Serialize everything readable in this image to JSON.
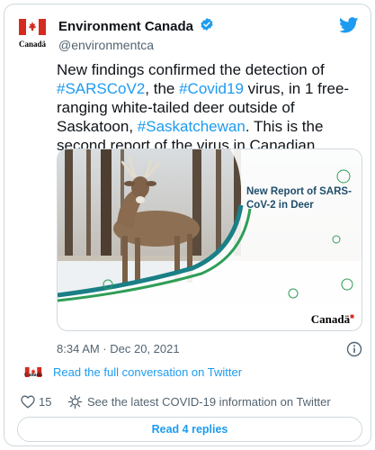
{
  "author": {
    "display_name": "Environment Canada",
    "handle": "@environmentca",
    "avatar_wordmark": "Canadä"
  },
  "tweet": {
    "segments": [
      {
        "text": "New findings confirmed the detection of ",
        "type": "text"
      },
      {
        "text": "#SARSCoV2",
        "type": "hashtag"
      },
      {
        "text": ", the ",
        "type": "text"
      },
      {
        "text": "#Covid19",
        "type": "hashtag"
      },
      {
        "text": " virus, in 1 free-ranging white-tailed deer outside of Saskatoon, ",
        "type": "text"
      },
      {
        "text": "#Saskatchewan",
        "type": "hashtag"
      },
      {
        "text": ". This is the second report of the virus in Canadian wildlife.",
        "type": "text"
      }
    ]
  },
  "media": {
    "overlay_title": "New Report of SARS-CoV-2 in Deer",
    "wordmark": "Canadä"
  },
  "meta": {
    "timestamp": "8:34 AM · Dec 20, 2021"
  },
  "conversation": {
    "link_text": "Read the full conversation on Twitter",
    "flag_wordmark": "Canadä"
  },
  "actions": {
    "like_count": "15",
    "covid_link": "See the latest COVID-19 information on Twitter"
  },
  "replies_button": "Read 4 replies",
  "colors": {
    "accent": "#1d9bf0",
    "canada_red": "#d52b1e",
    "overlay_teal": "#1a7f86",
    "overlay_green": "#2f9e57"
  },
  "icons": {
    "header": "twitter-bird-icon",
    "verified": "verified-badge-icon",
    "info": "info-icon",
    "like": "heart-icon",
    "covid": "covid-info-icon"
  }
}
